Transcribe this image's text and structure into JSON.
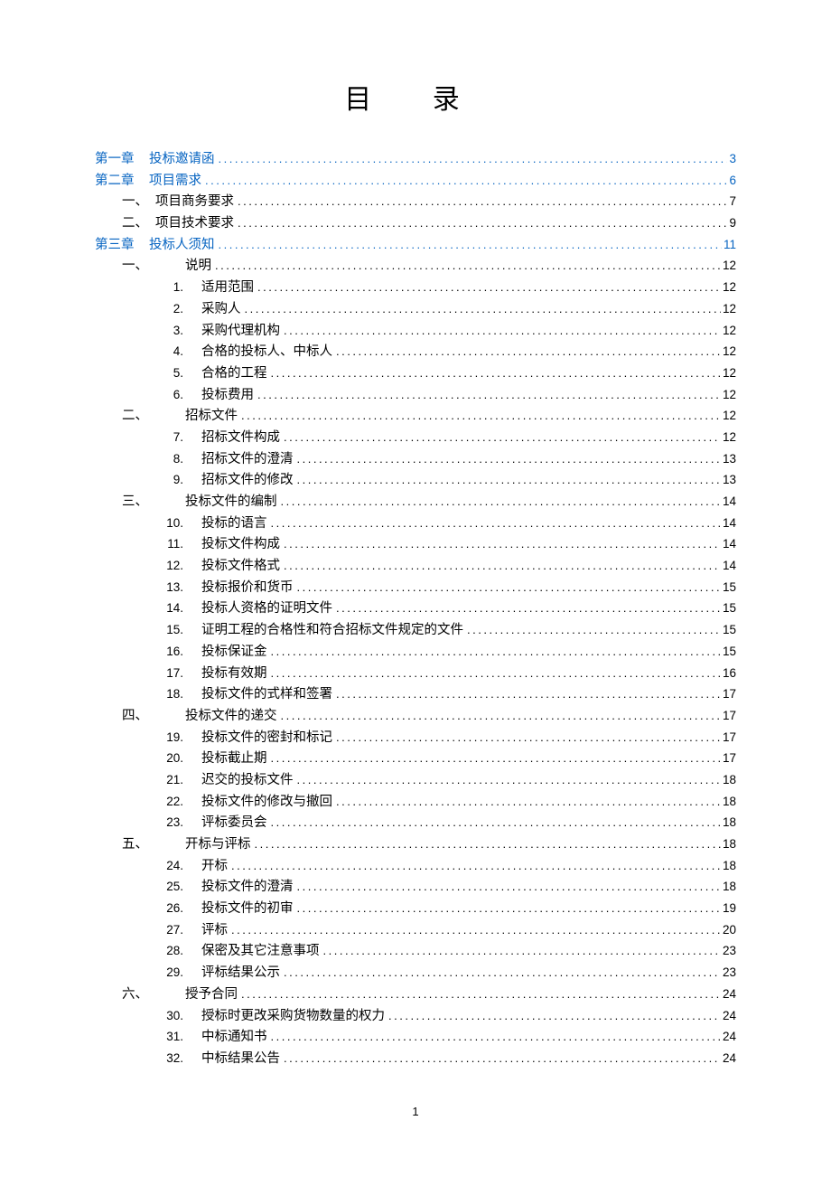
{
  "title": "目 录",
  "page_number": "1",
  "toc": [
    {
      "level": 0,
      "prefix": "第一章",
      "label": "投标邀请函",
      "page": "3",
      "link": true
    },
    {
      "level": 0,
      "prefix": "第二章",
      "label": "项目需求",
      "page": "6",
      "link": true
    },
    {
      "level": 1,
      "prefix": "一、",
      "label": "项目商务要求",
      "page": "7",
      "link": false
    },
    {
      "level": 1,
      "prefix": "二、",
      "label": "项目技术要求",
      "page": "9",
      "link": false
    },
    {
      "level": 0,
      "prefix": "第三章",
      "label": "投标人须知",
      "page": "11",
      "link": true
    },
    {
      "level": 2,
      "prefix": "一、",
      "label": "说明",
      "page": "12",
      "link": false
    },
    {
      "level": 3,
      "prefix": "1.",
      "label": "适用范围",
      "page": "12",
      "link": false
    },
    {
      "level": 3,
      "prefix": "2.",
      "label": "采购人",
      "page": "12",
      "link": false
    },
    {
      "level": 3,
      "prefix": "3.",
      "label": "采购代理机构",
      "page": "12",
      "link": false
    },
    {
      "level": 3,
      "prefix": "4.",
      "label": "合格的投标人、中标人",
      "page": "12",
      "link": false
    },
    {
      "level": 3,
      "prefix": "5.",
      "label": "合格的工程",
      "page": "12",
      "link": false
    },
    {
      "level": 3,
      "prefix": "6.",
      "label": "投标费用",
      "page": "12",
      "link": false
    },
    {
      "level": 2,
      "prefix": "二、",
      "label": "招标文件",
      "page": "12",
      "link": false
    },
    {
      "level": 3,
      "prefix": "7.",
      "label": "招标文件构成",
      "page": "12",
      "link": false
    },
    {
      "level": 3,
      "prefix": "8.",
      "label": "招标文件的澄清",
      "page": "13",
      "link": false
    },
    {
      "level": 3,
      "prefix": "9.",
      "label": "招标文件的修改",
      "page": "13",
      "link": false
    },
    {
      "level": 2,
      "prefix": "三、",
      "label": "投标文件的编制",
      "page": "14",
      "link": false
    },
    {
      "level": 3,
      "prefix": "10.",
      "label": "投标的语言",
      "page": "14",
      "link": false
    },
    {
      "level": 3,
      "prefix": "11.",
      "label": "投标文件构成",
      "page": "14",
      "link": false
    },
    {
      "level": 3,
      "prefix": "12.",
      "label": "投标文件格式",
      "page": "14",
      "link": false
    },
    {
      "level": 3,
      "prefix": "13.",
      "label": "投标报价和货币",
      "page": "15",
      "link": false
    },
    {
      "level": 3,
      "prefix": "14.",
      "label": "投标人资格的证明文件",
      "page": "15",
      "link": false
    },
    {
      "level": 3,
      "prefix": "15.",
      "label": "证明工程的合格性和符合招标文件规定的文件",
      "page": "15",
      "link": false
    },
    {
      "level": 3,
      "prefix": "16.",
      "label": "投标保证金",
      "page": "15",
      "link": false
    },
    {
      "level": 3,
      "prefix": "17.",
      "label": "投标有效期",
      "page": "16",
      "link": false
    },
    {
      "level": 3,
      "prefix": "18.",
      "label": "投标文件的式样和签署",
      "page": "17",
      "link": false
    },
    {
      "level": 2,
      "prefix": "四、",
      "label": "投标文件的递交",
      "page": "17",
      "link": false
    },
    {
      "level": 3,
      "prefix": "19.",
      "label": "投标文件的密封和标记",
      "page": "17",
      "link": false
    },
    {
      "level": 3,
      "prefix": "20.",
      "label": "投标截止期",
      "page": "17",
      "link": false
    },
    {
      "level": 3,
      "prefix": "21.",
      "label": "迟交的投标文件",
      "page": "18",
      "link": false
    },
    {
      "level": 3,
      "prefix": "22.",
      "label": "投标文件的修改与撤回",
      "page": "18",
      "link": false
    },
    {
      "level": 3,
      "prefix": "23.",
      "label": "评标委员会",
      "page": "18",
      "link": false
    },
    {
      "level": 2,
      "prefix": "五、",
      "label": "开标与评标",
      "page": "18",
      "link": false
    },
    {
      "level": 3,
      "prefix": "24.",
      "label": "开标",
      "page": "18",
      "link": false
    },
    {
      "level": 3,
      "prefix": "25.",
      "label": "投标文件的澄清",
      "page": "18",
      "link": false
    },
    {
      "level": 3,
      "prefix": "26.",
      "label": "投标文件的初审",
      "page": "19",
      "link": false
    },
    {
      "level": 3,
      "prefix": "27.",
      "label": "评标",
      "page": "20",
      "link": false
    },
    {
      "level": 3,
      "prefix": "28.",
      "label": "保密及其它注意事项",
      "page": "23",
      "link": false
    },
    {
      "level": 3,
      "prefix": "29.",
      "label": "评标结果公示",
      "page": "23",
      "link": false
    },
    {
      "level": 2,
      "prefix": "六、",
      "label": "授予合同",
      "page": "24",
      "link": false
    },
    {
      "level": 3,
      "prefix": "30.",
      "label": "授标时更改采购货物数量的权力",
      "page": "24",
      "link": false
    },
    {
      "level": 3,
      "prefix": "31.",
      "label": "中标通知书",
      "page": "24",
      "link": false
    },
    {
      "level": 3,
      "prefix": "32.",
      "label": "中标结果公告",
      "page": "24",
      "link": false
    }
  ]
}
